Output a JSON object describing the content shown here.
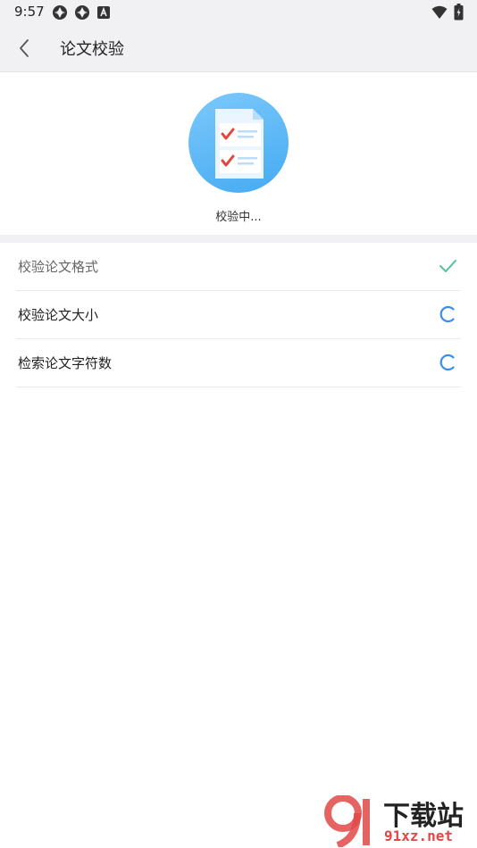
{
  "status_bar": {
    "time": "9:57",
    "icons": [
      "app-notification-icon",
      "app-notification-icon",
      "a-badge-icon",
      "wifi-icon",
      "battery-icon"
    ]
  },
  "app_bar": {
    "title": "论文校验",
    "back_icon": "chevron-left-icon"
  },
  "hero": {
    "icon": "document-checklist-icon",
    "status_text": "校验中..."
  },
  "checks": [
    {
      "label": "校验论文格式",
      "state": "done",
      "icon": "check-icon"
    },
    {
      "label": "校验论文大小",
      "state": "loading",
      "icon": "loading-spinner-icon"
    },
    {
      "label": "检索论文字符数",
      "state": "loading",
      "icon": "loading-spinner-icon"
    }
  ],
  "watermark": {
    "big": "下载站",
    "small": "91xz.net"
  },
  "colors": {
    "accent_blue": "#3b8ef0",
    "check_green": "#52c49a",
    "header_bg": "#f1f1f3"
  }
}
